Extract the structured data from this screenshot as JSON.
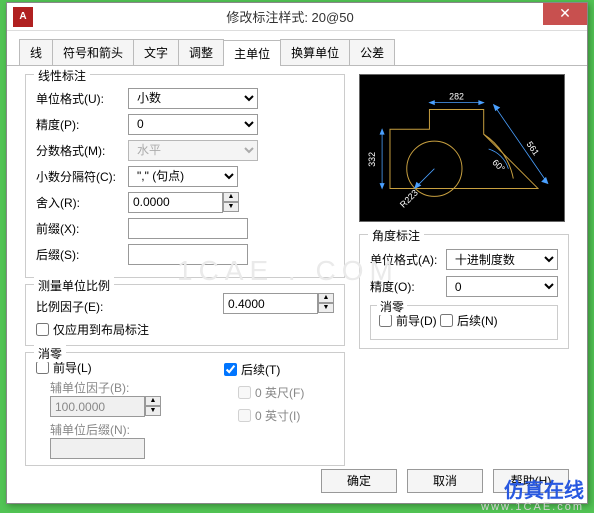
{
  "dialog": {
    "title": "修改标注样式: 20@50",
    "close_glyph": "✕"
  },
  "tabs": [
    "线",
    "符号和箭头",
    "文字",
    "调整",
    "主单位",
    "换算单位",
    "公差"
  ],
  "active_tab": 4,
  "linear": {
    "group_title": "线性标注",
    "unit_format": {
      "label": "单位格式(U):",
      "value": "小数"
    },
    "precision": {
      "label": "精度(P):",
      "value": "0"
    },
    "fraction": {
      "label": "分数格式(M):",
      "value": "水平",
      "disabled": true
    },
    "decimal_sep": {
      "label": "小数分隔符(C):",
      "value": "\",\"  (句点)"
    },
    "roundoff": {
      "label": "舍入(R):",
      "value": "0.0000"
    },
    "prefix": {
      "label": "前缀(X):",
      "value": ""
    },
    "suffix": {
      "label": "后缀(S):",
      "value": ""
    }
  },
  "measure": {
    "group_title": "测量单位比例",
    "scale_factor": {
      "label": "比例因子(E):",
      "value": "0.4000"
    },
    "layout_only": {
      "label": "仅应用到布局标注",
      "checked": false
    }
  },
  "zero": {
    "group_title": "消零",
    "leading": {
      "label": "前导(L)",
      "checked": false
    },
    "sub_factor": {
      "label": "辅单位因子(B):",
      "value": "100.0000",
      "disabled": true
    },
    "sub_suffix": {
      "label": "辅单位后缀(N):",
      "value": "",
      "disabled": true
    },
    "trailing": {
      "label": "后续(T)",
      "checked": true
    },
    "feet": {
      "label": "0 英尺(F)",
      "checked": false,
      "disabled": true
    },
    "inches": {
      "label": "0 英寸(I)",
      "checked": false,
      "disabled": true
    }
  },
  "angular": {
    "group_title": "角度标注",
    "unit_format": {
      "label": "单位格式(A):",
      "value": "十进制度数"
    },
    "precision": {
      "label": "精度(O):",
      "value": "0"
    },
    "zero": {
      "group_title": "消零",
      "leading": {
        "label": "前导(D)",
        "checked": false
      },
      "trailing": {
        "label": "后续(N)",
        "checked": false
      }
    }
  },
  "preview_dims": {
    "top": "282",
    "left": "332",
    "right": "561",
    "angle": "60°",
    "radius": "R223"
  },
  "buttons": {
    "ok": "确定",
    "cancel": "取消",
    "help": "帮助(H)"
  },
  "watermark": {
    "cn": "仿真在线",
    "url": "www.1CAE.com",
    "mid": "1CAE . COM"
  }
}
